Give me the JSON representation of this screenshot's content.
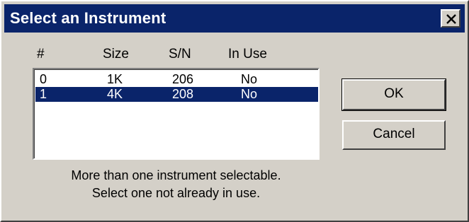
{
  "window": {
    "title": "Select an Instrument"
  },
  "list": {
    "columns": [
      "#",
      "Size",
      "S/N",
      "In Use"
    ],
    "rows": [
      {
        "num": "0",
        "size": "1K",
        "sn": "206",
        "in_use": "No",
        "selected": false
      },
      {
        "num": "1",
        "size": "4K",
        "sn": "208",
        "in_use": "No",
        "selected": true
      }
    ]
  },
  "buttons": {
    "ok": "OK",
    "cancel": "Cancel"
  },
  "message": {
    "line1": "More than one instrument selectable.",
    "line2": "Select one not already in use."
  },
  "colors": {
    "titlebar": "#0a246a",
    "face": "#d4d0c8",
    "selection": "#0a246a"
  }
}
